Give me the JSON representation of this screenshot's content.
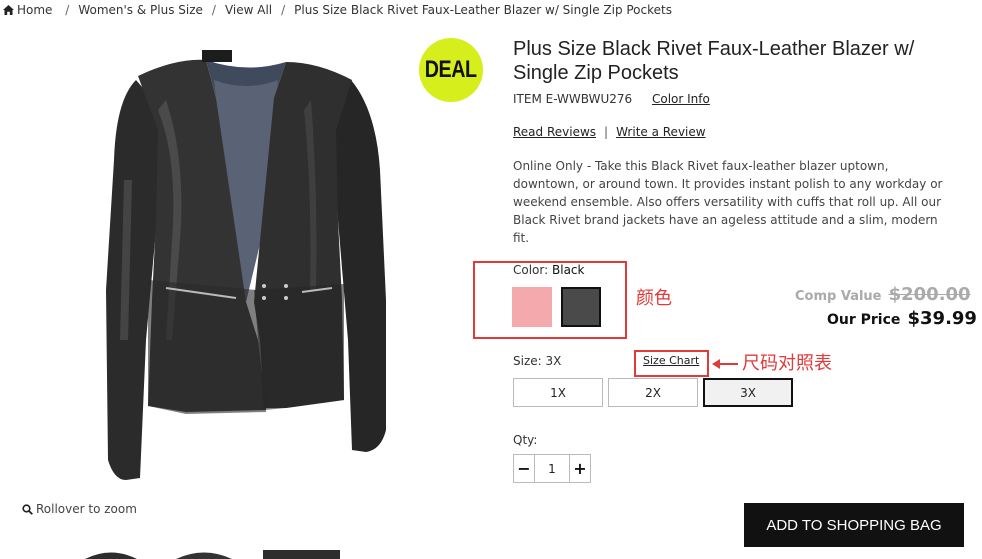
{
  "breadcrumb": {
    "home": "Home",
    "items": [
      "Women's & Plus Size",
      "View All",
      "Plus Size Black Rivet Faux-Leather Blazer w/ Single Zip Pockets"
    ]
  },
  "badge": {
    "text": "DEAL",
    "color": "#d6ef1c"
  },
  "product": {
    "title": "Plus Size Black Rivet Faux-Leather Blazer w/ Single Zip Pockets",
    "item_number": "ITEM E-WWBWU276",
    "color_info_link": "Color Info",
    "read_reviews": "Read Reviews",
    "separator": "|",
    "write_review": "Write a Review",
    "description": "Online Only - Take this Black Rivet faux-leather blazer uptown, downtown, or around town. It provides instant polish to any workday or weekend ensemble. Also offers versatility with cuffs that roll up. All our Black Rivet brand jackets have an ageless attitude and a slim, modern fit."
  },
  "color": {
    "label": "Color:",
    "selected": "Black",
    "swatches": [
      {
        "name": "pink",
        "hex": "#f4a9ad"
      },
      {
        "name": "black",
        "hex": "#4a4a4a"
      }
    ]
  },
  "pricing": {
    "comp_label": "Comp Value",
    "comp_value": "$200.00",
    "our_label": "Our Price",
    "our_value": "$39.99"
  },
  "size": {
    "label": "Size: 3X",
    "chart_link": "Size Chart",
    "options": [
      "1X",
      "2X",
      "3X"
    ],
    "selected": "3X"
  },
  "quantity": {
    "label": "Qty:",
    "minus": "−",
    "value": "1",
    "plus": "+"
  },
  "zoom": {
    "label": "Rollover to zoom"
  },
  "cart": {
    "add_label": "ADD TO SHOPPING BAG"
  },
  "annotations": {
    "color_note": "颜色",
    "size_chart_note": "尺码对照表",
    "color": "#e03a3a"
  }
}
